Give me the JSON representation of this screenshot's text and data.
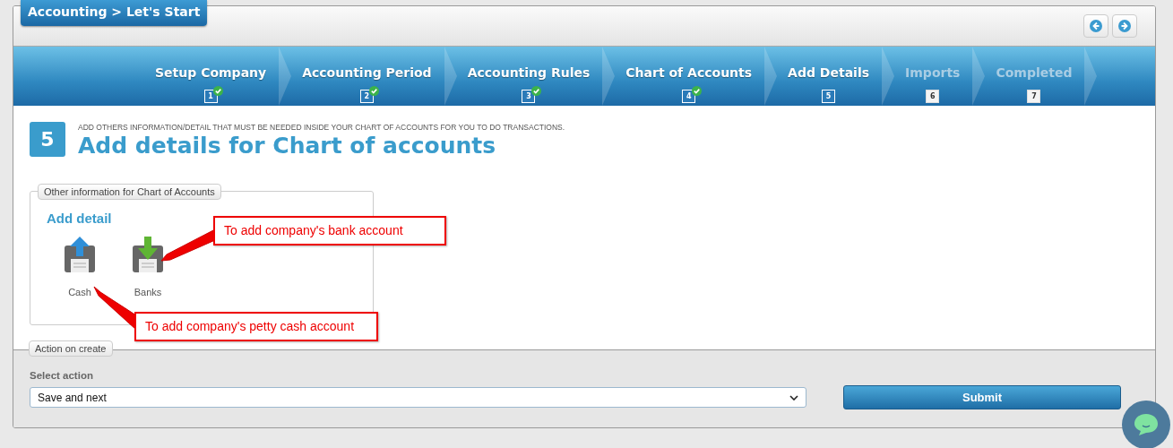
{
  "header": {
    "title": "Accounting > Let's Start"
  },
  "steps": [
    {
      "label": "Setup Company",
      "number": "1",
      "completed": true,
      "disabled": false
    },
    {
      "label": "Accounting Period",
      "number": "2",
      "completed": true,
      "disabled": false
    },
    {
      "label": "Accounting Rules",
      "number": "3",
      "completed": true,
      "disabled": false
    },
    {
      "label": "Chart of Accounts",
      "number": "4",
      "completed": true,
      "disabled": false
    },
    {
      "label": "Add Details",
      "number": "5",
      "completed": false,
      "disabled": false
    },
    {
      "label": "Imports",
      "number": "6",
      "completed": false,
      "disabled": true
    },
    {
      "label": "Completed",
      "number": "7",
      "completed": false,
      "disabled": true
    }
  ],
  "step_heading": {
    "number": "5",
    "subtitle": "ADD OTHERS INFORMATION/DETAIL THAT MUST BE NEEDED INSIDE YOUR CHART OF ACCOUNTS FOR YOU TO DO TRANSACTIONS.",
    "title": "Add details for Chart of accounts"
  },
  "details_panel": {
    "legend": "Other information for Chart of Accounts",
    "heading": "Add detail",
    "items": [
      {
        "label": "Cash",
        "kind": "upload"
      },
      {
        "label": "Banks",
        "kind": "download"
      }
    ]
  },
  "callouts": [
    {
      "text": "To add company's bank account"
    },
    {
      "text": "To add company's petty cash account"
    }
  ],
  "action_panel": {
    "legend": "Action on create",
    "label": "Select action",
    "value": "Save and next",
    "button": "Submit"
  }
}
